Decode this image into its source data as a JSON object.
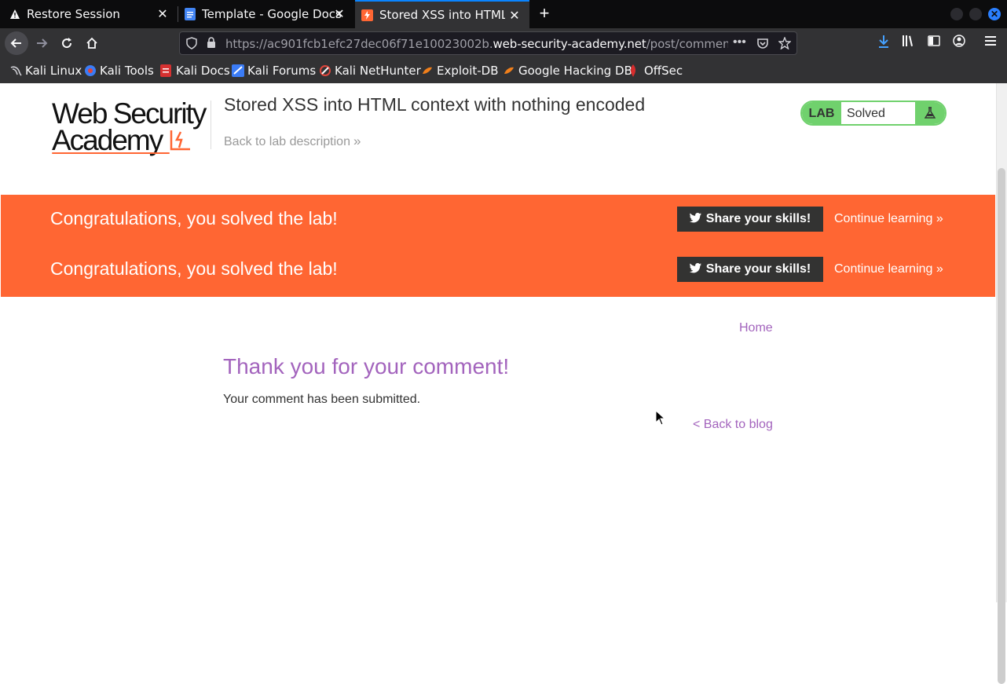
{
  "browser": {
    "tabs": [
      {
        "title": "Restore Session",
        "icon": "warning-icon"
      },
      {
        "title": "Template - Google Docs",
        "icon": "google-docs-icon"
      },
      {
        "title": "Stored XSS into HTML co",
        "icon": "web-security-academy-icon"
      }
    ],
    "url": {
      "prefix": "https://ac901fcb1efc27dec06f71e10023002b.",
      "domain": "web-security-academy.net",
      "path": "/post/comment/conf"
    },
    "bookmarks": [
      {
        "label": "Kali Linux",
        "icon": "kali-dragon-icon"
      },
      {
        "label": "Kali Tools",
        "icon": "kali-tools-icon"
      },
      {
        "label": "Kali Docs",
        "icon": "kali-docs-icon"
      },
      {
        "label": "Kali Forums",
        "icon": "kali-forums-icon"
      },
      {
        "label": "Kali NetHunter",
        "icon": "nethunter-icon"
      },
      {
        "label": "Exploit-DB",
        "icon": "exploit-db-icon"
      },
      {
        "label": "Google Hacking DB",
        "icon": "ghdb-icon"
      },
      {
        "label": "OffSec",
        "icon": "offsec-icon"
      }
    ]
  },
  "header": {
    "logo_line1": "Web Security",
    "logo_line2": "Academy",
    "lab_title": "Stored XSS into HTML context with nothing encoded",
    "back_to_description": "Back to lab description",
    "lab_badge_label": "LAB",
    "lab_status": "Solved"
  },
  "banner": {
    "message": "Congratulations, you solved the lab!",
    "share_button": "Share your skills!",
    "continue_link": "Continue learning"
  },
  "main": {
    "home_link": "Home",
    "heading": "Thank you for your comment!",
    "message": "Your comment has been submitted.",
    "back_link": "< Back to blog"
  },
  "colors": {
    "accent_orange": "#ff6633",
    "link_purple": "#a364bd",
    "lab_green": "#70d16d"
  }
}
